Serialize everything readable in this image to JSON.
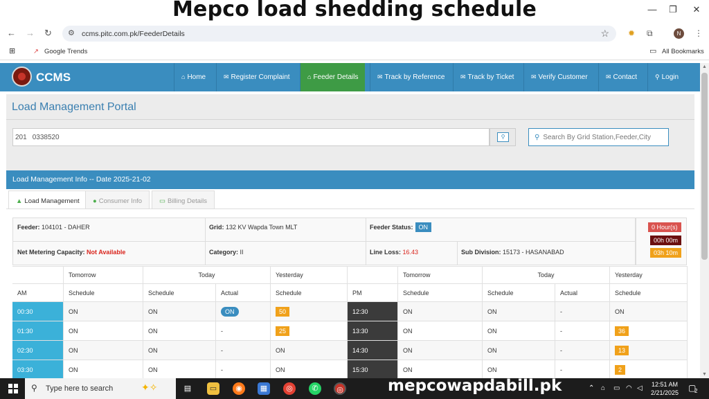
{
  "banner": {
    "title": "Mepco load shedding schedule"
  },
  "window_controls": {
    "minimize": "—",
    "restore": "❐",
    "close": "✕"
  },
  "browser": {
    "back": "←",
    "forward": "→",
    "reload": "↻",
    "url": "ccms.pitc.com.pk/FeederDetails",
    "avatar_initial": "N",
    "bookmarks": {
      "google_trends": "Google Trends",
      "all_bookmarks": "All Bookmarks"
    }
  },
  "site": {
    "brand": "CCMS",
    "nav": [
      {
        "label": "Home",
        "icon": "⌂"
      },
      {
        "label": "Register Complaint",
        "icon": "✉"
      },
      {
        "label": "Feeder Details",
        "icon": "⌂"
      },
      {
        "label": "Track by Reference",
        "icon": "✉"
      },
      {
        "label": "Track by Ticket",
        "icon": "✉"
      },
      {
        "label": "Verify Customer",
        "icon": "✉"
      },
      {
        "label": "Contact",
        "icon": "✉"
      },
      {
        "label": "Login",
        "icon": "⚲"
      }
    ]
  },
  "portal": {
    "title": "Load Management Portal",
    "reference_value": "201    0338520",
    "grid_search_placeholder": "Search By Grid Station,Feeder,City"
  },
  "info": {
    "header": "Load Management Info -- Date 2025-21-02",
    "tabs": [
      "Load Management",
      "Consumer Info",
      "Billing Details"
    ],
    "feeder_label": "Feeder:",
    "feeder_value": "104101 - DAHER",
    "grid_label": "Grid:",
    "grid_value": "132 KV Wapda Town MLT",
    "status_label": "Feeder Status:",
    "status_value": "ON",
    "net_label": "Net Metering Capacity:",
    "net_value": "Not Available",
    "category_label": "Category:",
    "category_value": "II",
    "lineloss_label": "Line Loss:",
    "lineloss_value": "16.43",
    "subdiv_label": "Sub Division:",
    "subdiv_value": "15173 - HASANABAD",
    "hours": [
      "0 Hour(s)",
      "00h 00m",
      "03h 10m"
    ]
  },
  "schedule": {
    "group_headers": {
      "tomorrow": "Tomorrow",
      "today": "Today",
      "yesterday": "Yesterday"
    },
    "col_headers": {
      "am": "AM",
      "pm": "PM",
      "schedule": "Schedule",
      "actual": "Actual"
    },
    "rows": [
      {
        "am": "00:30",
        "am_tomorrow": "ON",
        "am_today": "ON",
        "am_actual": "ON",
        "am_yesterday": "50",
        "pm": "12:30",
        "pm_tomorrow": "ON",
        "pm_today": "ON",
        "pm_actual": "-",
        "pm_yesterday": "ON"
      },
      {
        "am": "01:30",
        "am_tomorrow": "ON",
        "am_today": "ON",
        "am_actual": "-",
        "am_yesterday": "25",
        "pm": "13:30",
        "pm_tomorrow": "ON",
        "pm_today": "ON",
        "pm_actual": "-",
        "pm_yesterday": "36"
      },
      {
        "am": "02:30",
        "am_tomorrow": "ON",
        "am_today": "ON",
        "am_actual": "-",
        "am_yesterday": "ON",
        "pm": "14:30",
        "pm_tomorrow": "ON",
        "pm_today": "ON",
        "pm_actual": "-",
        "pm_yesterday": "13"
      },
      {
        "am": "03:30",
        "am_tomorrow": "ON",
        "am_today": "ON",
        "am_actual": "-",
        "am_yesterday": "ON",
        "pm": "15:30",
        "pm_tomorrow": "ON",
        "pm_today": "ON",
        "pm_actual": "-",
        "pm_yesterday": "2"
      }
    ]
  },
  "taskbar": {
    "search_placeholder": "Type here to search",
    "watermark": "mepcowapdabill.pk",
    "time": "12:51 AM",
    "date": "2/21/2025",
    "notifications": "2"
  },
  "colors": {
    "nav_blue": "#3a8dbf",
    "active_green": "#3e9b45",
    "am_cell": "#3bb1d9",
    "pm_cell": "#3b3b3b",
    "orange_badge": "#f0a11a",
    "hour_red": "#d9534f",
    "hour_dark": "#6b0f0f",
    "hour_orange": "#f0a11a"
  }
}
